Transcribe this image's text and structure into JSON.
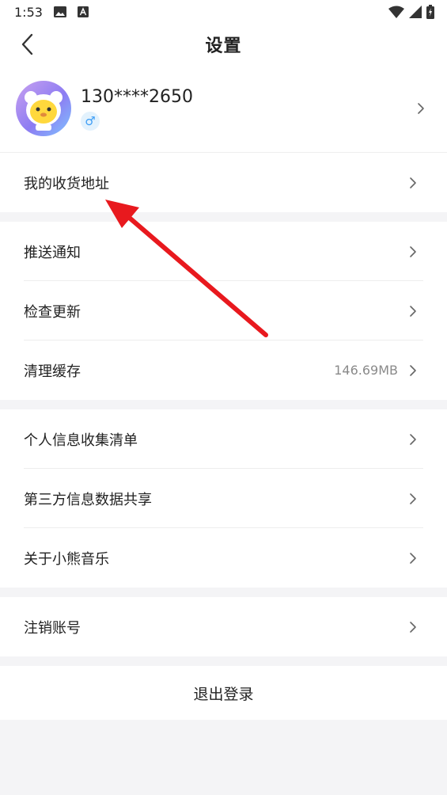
{
  "status_bar": {
    "time": "1:53"
  },
  "header": {
    "title": "设置"
  },
  "profile": {
    "phone": "130****2650",
    "gender_symbol": "♂"
  },
  "groups": [
    {
      "rows": [
        {
          "label": "我的收货地址"
        }
      ]
    },
    {
      "rows": [
        {
          "label": "推送通知"
        },
        {
          "label": "检查更新"
        },
        {
          "label": "清理缓存",
          "value": "146.69MB"
        }
      ]
    },
    {
      "rows": [
        {
          "label": "个人信息收集清单"
        },
        {
          "label": "第三方信息数据共享"
        },
        {
          "label": "关于小熊音乐"
        }
      ]
    },
    {
      "rows": [
        {
          "label": "注销账号"
        }
      ]
    }
  ],
  "logout": {
    "label": "退出登录"
  },
  "colors": {
    "annotation_arrow": "#e8191e",
    "gender_blue": "#3d9df5",
    "background": "#f4f4f6"
  }
}
